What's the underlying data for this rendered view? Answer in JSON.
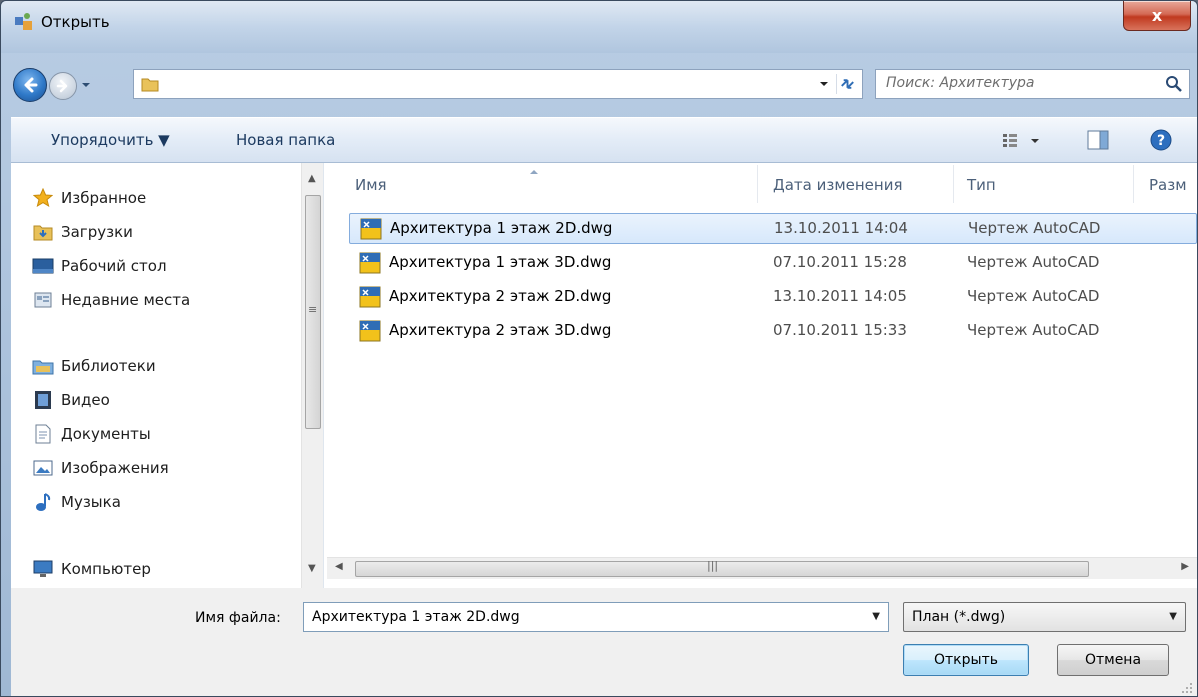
{
  "window": {
    "title": "Открыть",
    "close_label": "x"
  },
  "navigation": {
    "address_path": "",
    "search_placeholder": "Поиск: Архитектура"
  },
  "toolbar": {
    "organize_label": "Упорядочить ▼",
    "new_folder_label": "Новая папка"
  },
  "sidebar": {
    "items": [
      {
        "label": "Избранное",
        "icon": "star-icon"
      },
      {
        "label": "Загрузки",
        "icon": "downloads-folder-icon"
      },
      {
        "label": "Рабочий стол",
        "icon": "desktop-icon"
      },
      {
        "label": "Недавние места",
        "icon": "recent-places-icon"
      },
      {
        "label": "Библиотеки",
        "icon": "libraries-icon"
      },
      {
        "label": "Видео",
        "icon": "video-icon"
      },
      {
        "label": "Документы",
        "icon": "documents-icon"
      },
      {
        "label": "Изображения",
        "icon": "pictures-icon"
      },
      {
        "label": "Музыка",
        "icon": "music-icon"
      },
      {
        "label": "Компьютер",
        "icon": "computer-icon"
      }
    ]
  },
  "file_list": {
    "columns": [
      "Имя",
      "Дата изменения",
      "Тип",
      "Разм"
    ],
    "rows": [
      {
        "name": "Архитектура 1 этаж 2D.dwg",
        "date": "13.10.2011 14:04",
        "type": "Чертеж AutoCAD",
        "selected": true
      },
      {
        "name": "Архитектура 1 этаж 3D.dwg",
        "date": "07.10.2011 15:28",
        "type": "Чертеж AutoCAD",
        "selected": false
      },
      {
        "name": "Архитектура 2 этаж 2D.dwg",
        "date": "13.10.2011 14:05",
        "type": "Чертеж AutoCAD",
        "selected": false
      },
      {
        "name": "Архитектура 2 этаж 3D.dwg",
        "date": "07.10.2011 15:33",
        "type": "Чертеж AutoCAD",
        "selected": false
      }
    ]
  },
  "footer": {
    "filename_label": "Имя файла:",
    "filename_value": "Архитектура 1 этаж 2D.dwg",
    "filetype_value": "План (*.dwg)",
    "open_label": "Открыть",
    "cancel_label": "Отмена"
  },
  "colors": {
    "accent": "#3c7fb1",
    "selection": "#d7e8fb",
    "close": "#c0391f"
  }
}
